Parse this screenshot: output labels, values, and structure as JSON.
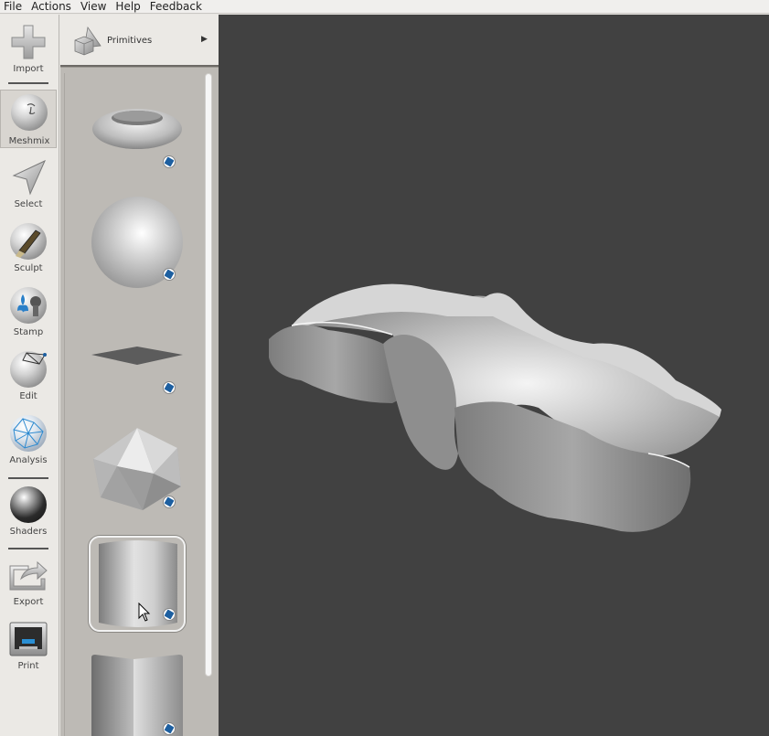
{
  "menubar": {
    "items": [
      "File",
      "Actions",
      "View",
      "Help",
      "Feedback"
    ]
  },
  "toolbar": {
    "tools": [
      {
        "label": "Import",
        "icon": "plus-icon"
      },
      {
        "label": "Meshmix",
        "icon": "meshmix-icon",
        "active": true
      },
      {
        "label": "Select",
        "icon": "cursor-arrow-icon"
      },
      {
        "label": "Sculpt",
        "icon": "brush-icon"
      },
      {
        "label": "Stamp",
        "icon": "stamp-icon"
      },
      {
        "label": "Edit",
        "icon": "edit-icon"
      },
      {
        "label": "Analysis",
        "icon": "analysis-icon"
      },
      {
        "label": "Shaders",
        "icon": "shader-ball-icon"
      },
      {
        "label": "Export",
        "icon": "export-icon"
      },
      {
        "label": "Print",
        "icon": "printer-icon"
      }
    ]
  },
  "panel": {
    "title": "Primitives",
    "title_icon": "primitives-icon",
    "items": [
      {
        "shape": "torus"
      },
      {
        "shape": "sphere"
      },
      {
        "shape": "plane"
      },
      {
        "shape": "icosahedron"
      },
      {
        "shape": "cylinder",
        "selected": true
      },
      {
        "shape": "cube"
      }
    ]
  },
  "viewport": {
    "background": "#414141",
    "model": "sculpted-mesh"
  }
}
